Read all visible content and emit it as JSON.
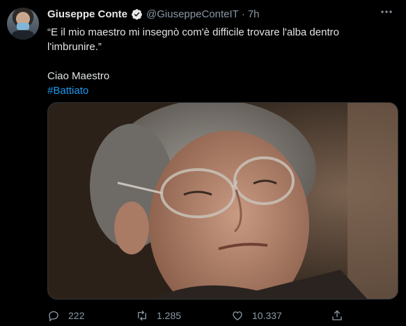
{
  "tweet": {
    "author_name": "Giuseppe Conte",
    "author_handle": "@GiuseppeConteIT",
    "separator": "·",
    "time": "7h",
    "text_line1": "“E il mio maestro mi insegnò com'è difficile trovare l'alba dentro l'imbrunire.”",
    "text_line2": "Ciao Maestro",
    "hashtag": "#Battiato"
  },
  "actions": {
    "reply_count": "222",
    "retweet_count": "1.285",
    "like_count": "10.337"
  },
  "colors": {
    "background": "#000000",
    "accent": "#1d9bf0",
    "muted": "#8b98a5"
  },
  "icons": [
    "verified-icon",
    "more-icon",
    "reply-icon",
    "retweet-icon",
    "like-icon",
    "share-icon"
  ]
}
